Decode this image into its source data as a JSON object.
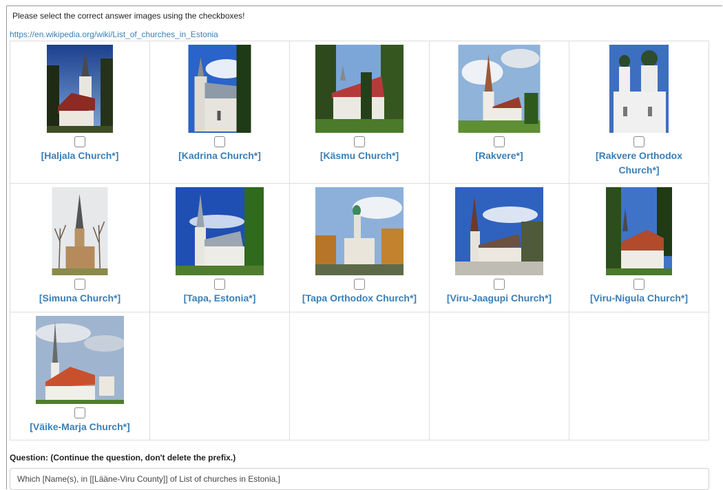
{
  "instruction": "Please select the correct answer images using the checkboxes!",
  "source_link": "https://en.wikipedia.org/wiki/List_of_churches_in_Estonia",
  "items": [
    {
      "label": "[Haljala Church*]",
      "icon": "church-photo-icon"
    },
    {
      "label": "[Kadrina Church*]",
      "icon": "church-photo-icon"
    },
    {
      "label": "[Käsmu Church*]",
      "icon": "church-photo-icon"
    },
    {
      "label": "[Rakvere*]",
      "icon": "church-photo-icon"
    },
    {
      "label": "[Rakvere Orthodox Church*]",
      "icon": "orthodox-church-photo-icon"
    },
    {
      "label": "[Simuna Church*]",
      "icon": "church-photo-icon"
    },
    {
      "label": "[Tapa, Estonia*]",
      "icon": "church-photo-icon"
    },
    {
      "label": "[Tapa Orthodox Church*]",
      "icon": "orthodox-church-photo-icon"
    },
    {
      "label": "[Viru-Jaagupi Church*]",
      "icon": "church-photo-icon"
    },
    {
      "label": "[Viru-Nigula Church*]",
      "icon": "church-photo-icon"
    },
    {
      "label": "[Väike-Marja Church*]",
      "icon": "church-photo-icon"
    }
  ],
  "question": {
    "label": "Question: (Continue the question, don't delete the prefix.)",
    "value": "Which [Name(s), in [[Lääne-Viru County]] of List of churches in Estonia,]"
  },
  "colors": {
    "link": "#3a7fb7",
    "border": "#dddddd"
  }
}
